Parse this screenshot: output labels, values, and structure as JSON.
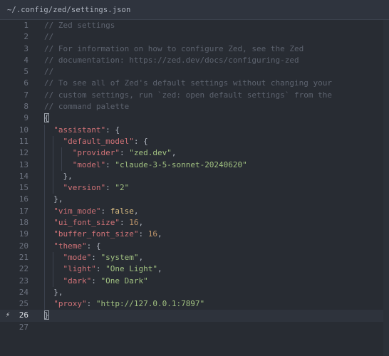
{
  "window": {
    "path": "~/.config/zed/settings.json"
  },
  "editor": {
    "active_line": 26,
    "lines": [
      {
        "n": "1",
        "tokens": [
          [
            "c",
            "// Zed settings"
          ]
        ]
      },
      {
        "n": "2",
        "tokens": [
          [
            "c",
            "//"
          ]
        ]
      },
      {
        "n": "3",
        "tokens": [
          [
            "c",
            "// For information on how to configure Zed, see the Zed"
          ]
        ]
      },
      {
        "n": "4",
        "tokens": [
          [
            "c",
            "// documentation: https://zed.dev/docs/configuring-zed"
          ]
        ]
      },
      {
        "n": "5",
        "tokens": [
          [
            "c",
            "//"
          ]
        ]
      },
      {
        "n": "6",
        "tokens": [
          [
            "c",
            "// To see all of Zed's default settings without changing your"
          ]
        ]
      },
      {
        "n": "7",
        "tokens": [
          [
            "c",
            "// custom settings, run `zed: open default settings` from the"
          ]
        ]
      },
      {
        "n": "8",
        "tokens": [
          [
            "c",
            "// command palette"
          ]
        ]
      },
      {
        "n": "9",
        "tokens": [
          [
            "p",
            "{"
          ]
        ]
      },
      {
        "n": "10",
        "tokens": [
          [
            "p",
            "  "
          ],
          [
            "k",
            "\"assistant\""
          ],
          [
            "p",
            ": {"
          ]
        ]
      },
      {
        "n": "11",
        "tokens": [
          [
            "p",
            "    "
          ],
          [
            "k",
            "\"default_model\""
          ],
          [
            "p",
            ": {"
          ]
        ]
      },
      {
        "n": "12",
        "tokens": [
          [
            "p",
            "      "
          ],
          [
            "k",
            "\"provider\""
          ],
          [
            "p",
            ": "
          ],
          [
            "s",
            "\"zed.dev\""
          ],
          [
            "p",
            ","
          ]
        ]
      },
      {
        "n": "13",
        "tokens": [
          [
            "p",
            "      "
          ],
          [
            "k",
            "\"model\""
          ],
          [
            "p",
            ": "
          ],
          [
            "s",
            "\"claude-3-5-sonnet-20240620\""
          ]
        ]
      },
      {
        "n": "14",
        "tokens": [
          [
            "p",
            "    },"
          ]
        ]
      },
      {
        "n": "15",
        "tokens": [
          [
            "p",
            "    "
          ],
          [
            "k",
            "\"version\""
          ],
          [
            "p",
            ": "
          ],
          [
            "s",
            "\"2\""
          ]
        ]
      },
      {
        "n": "16",
        "tokens": [
          [
            "p",
            "  },"
          ]
        ]
      },
      {
        "n": "17",
        "tokens": [
          [
            "p",
            "  "
          ],
          [
            "k",
            "\"vim_mode\""
          ],
          [
            "p",
            ": "
          ],
          [
            "b",
            "false"
          ],
          [
            "p",
            ","
          ]
        ]
      },
      {
        "n": "18",
        "tokens": [
          [
            "p",
            "  "
          ],
          [
            "k",
            "\"ui_font_size\""
          ],
          [
            "p",
            ": "
          ],
          [
            "n",
            "16"
          ],
          [
            "p",
            ","
          ]
        ]
      },
      {
        "n": "19",
        "tokens": [
          [
            "p",
            "  "
          ],
          [
            "k",
            "\"buffer_font_size\""
          ],
          [
            "p",
            ": "
          ],
          [
            "n",
            "16"
          ],
          [
            "p",
            ","
          ]
        ]
      },
      {
        "n": "20",
        "tokens": [
          [
            "p",
            "  "
          ],
          [
            "k",
            "\"theme\""
          ],
          [
            "p",
            ": {"
          ]
        ]
      },
      {
        "n": "21",
        "tokens": [
          [
            "p",
            "    "
          ],
          [
            "k",
            "\"mode\""
          ],
          [
            "p",
            ": "
          ],
          [
            "s",
            "\"system\""
          ],
          [
            "p",
            ","
          ]
        ]
      },
      {
        "n": "22",
        "tokens": [
          [
            "p",
            "    "
          ],
          [
            "k",
            "\"light\""
          ],
          [
            "p",
            ": "
          ],
          [
            "s",
            "\"One Light\""
          ],
          [
            "p",
            ","
          ]
        ]
      },
      {
        "n": "23",
        "tokens": [
          [
            "p",
            "    "
          ],
          [
            "k",
            "\"dark\""
          ],
          [
            "p",
            ": "
          ],
          [
            "s",
            "\"One Dark\""
          ]
        ]
      },
      {
        "n": "24",
        "tokens": [
          [
            "p",
            "  },"
          ]
        ]
      },
      {
        "n": "25",
        "tokens": [
          [
            "p",
            "  "
          ],
          [
            "k",
            "\"proxy\""
          ],
          [
            "p",
            ": "
          ],
          [
            "s",
            "\"http://127.0.0.1:7897\""
          ]
        ]
      },
      {
        "n": "26",
        "tokens": [
          [
            "p",
            "}"
          ]
        ]
      },
      {
        "n": "27",
        "tokens": []
      }
    ]
  },
  "icons": {
    "git_gutter": "lightning-icon"
  },
  "colors": {
    "background": "#282c33",
    "comment": "#5d636f",
    "key": "#d07277",
    "string": "#a1c181",
    "number": "#bf956a",
    "boolean": "#dfc184"
  }
}
